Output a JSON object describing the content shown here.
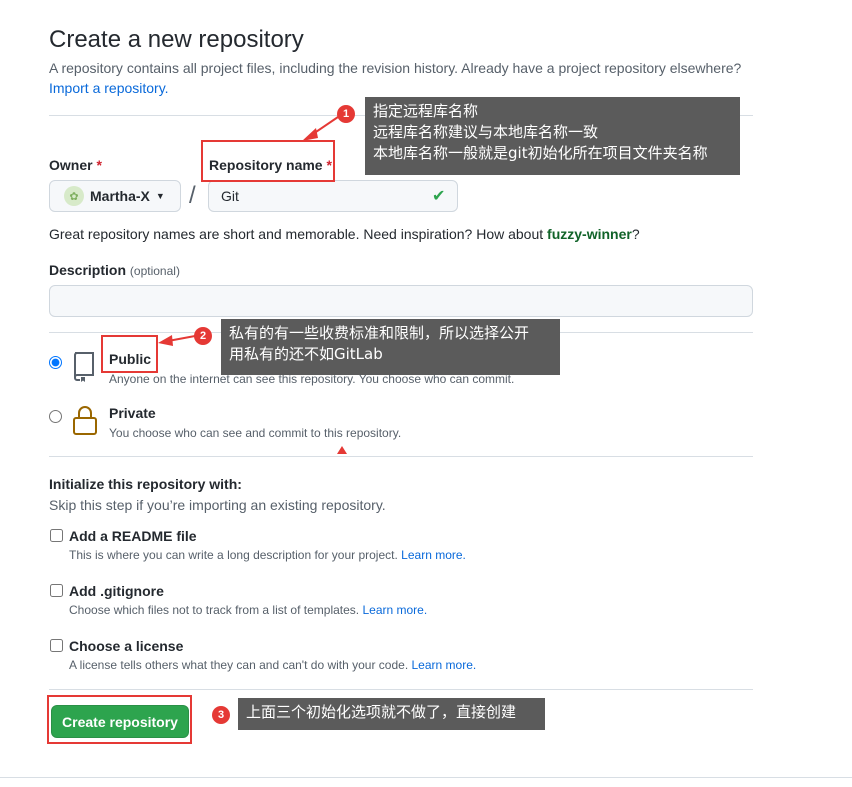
{
  "page": {
    "title": "Create a new repository",
    "subtitle": "A repository contains all project files, including the revision history. Already have a project repository elsewhere?",
    "import_link": "Import a repository."
  },
  "owner": {
    "label": "Owner",
    "required_mark": "*",
    "value": "Martha-X"
  },
  "repo_name": {
    "label": "Repository name",
    "required_mark": "*",
    "value": "Git",
    "separator": "/"
  },
  "name_hint": {
    "text": "Great repository names are short and memorable. Need inspiration? How about ",
    "suggestion": "fuzzy-winner",
    "end": "?"
  },
  "description": {
    "label": "Description",
    "optional": "(optional)",
    "value": ""
  },
  "visibility": {
    "selected": "public",
    "public": {
      "title": "Public",
      "desc": "Anyone on the internet can see this repository. You choose who can commit."
    },
    "private": {
      "title": "Private",
      "desc": "You choose who can see and commit to this repository."
    }
  },
  "initialize": {
    "title": "Initialize this repository with:",
    "subtitle": "Skip this step if you’re importing an existing repository.",
    "learn_more": "Learn more.",
    "options": [
      {
        "title": "Add a README file",
        "desc": "This is where you can write a long description for your project.",
        "checked": false
      },
      {
        "title": "Add .gitignore",
        "desc": "Choose which files not to track from a list of templates.",
        "checked": false
      },
      {
        "title": "Choose a license",
        "desc": "A license tells others what they can and can't do with your code.",
        "checked": false
      }
    ]
  },
  "create_button": "Create repository",
  "annotations": {
    "note1": {
      "number": "1",
      "lines": [
        "指定远程库名称",
        "远程库名称建议与本地库名称一致",
        "本地库名称一般就是git初始化所在项目文件夹名称"
      ]
    },
    "note2": {
      "number": "2",
      "lines": [
        "私有的有一些收费标准和限制，所以选择公开",
        "用私有的还不如GitLab"
      ]
    },
    "note3": {
      "number": "3",
      "lines": [
        "上面三个初始化选项就不做了，直接创建"
      ]
    }
  },
  "colors": {
    "accent_blue": "#0969da",
    "success_green": "#2da44e",
    "annotation_red": "#e53935",
    "tooltip_bg": "#5b5b5b"
  }
}
